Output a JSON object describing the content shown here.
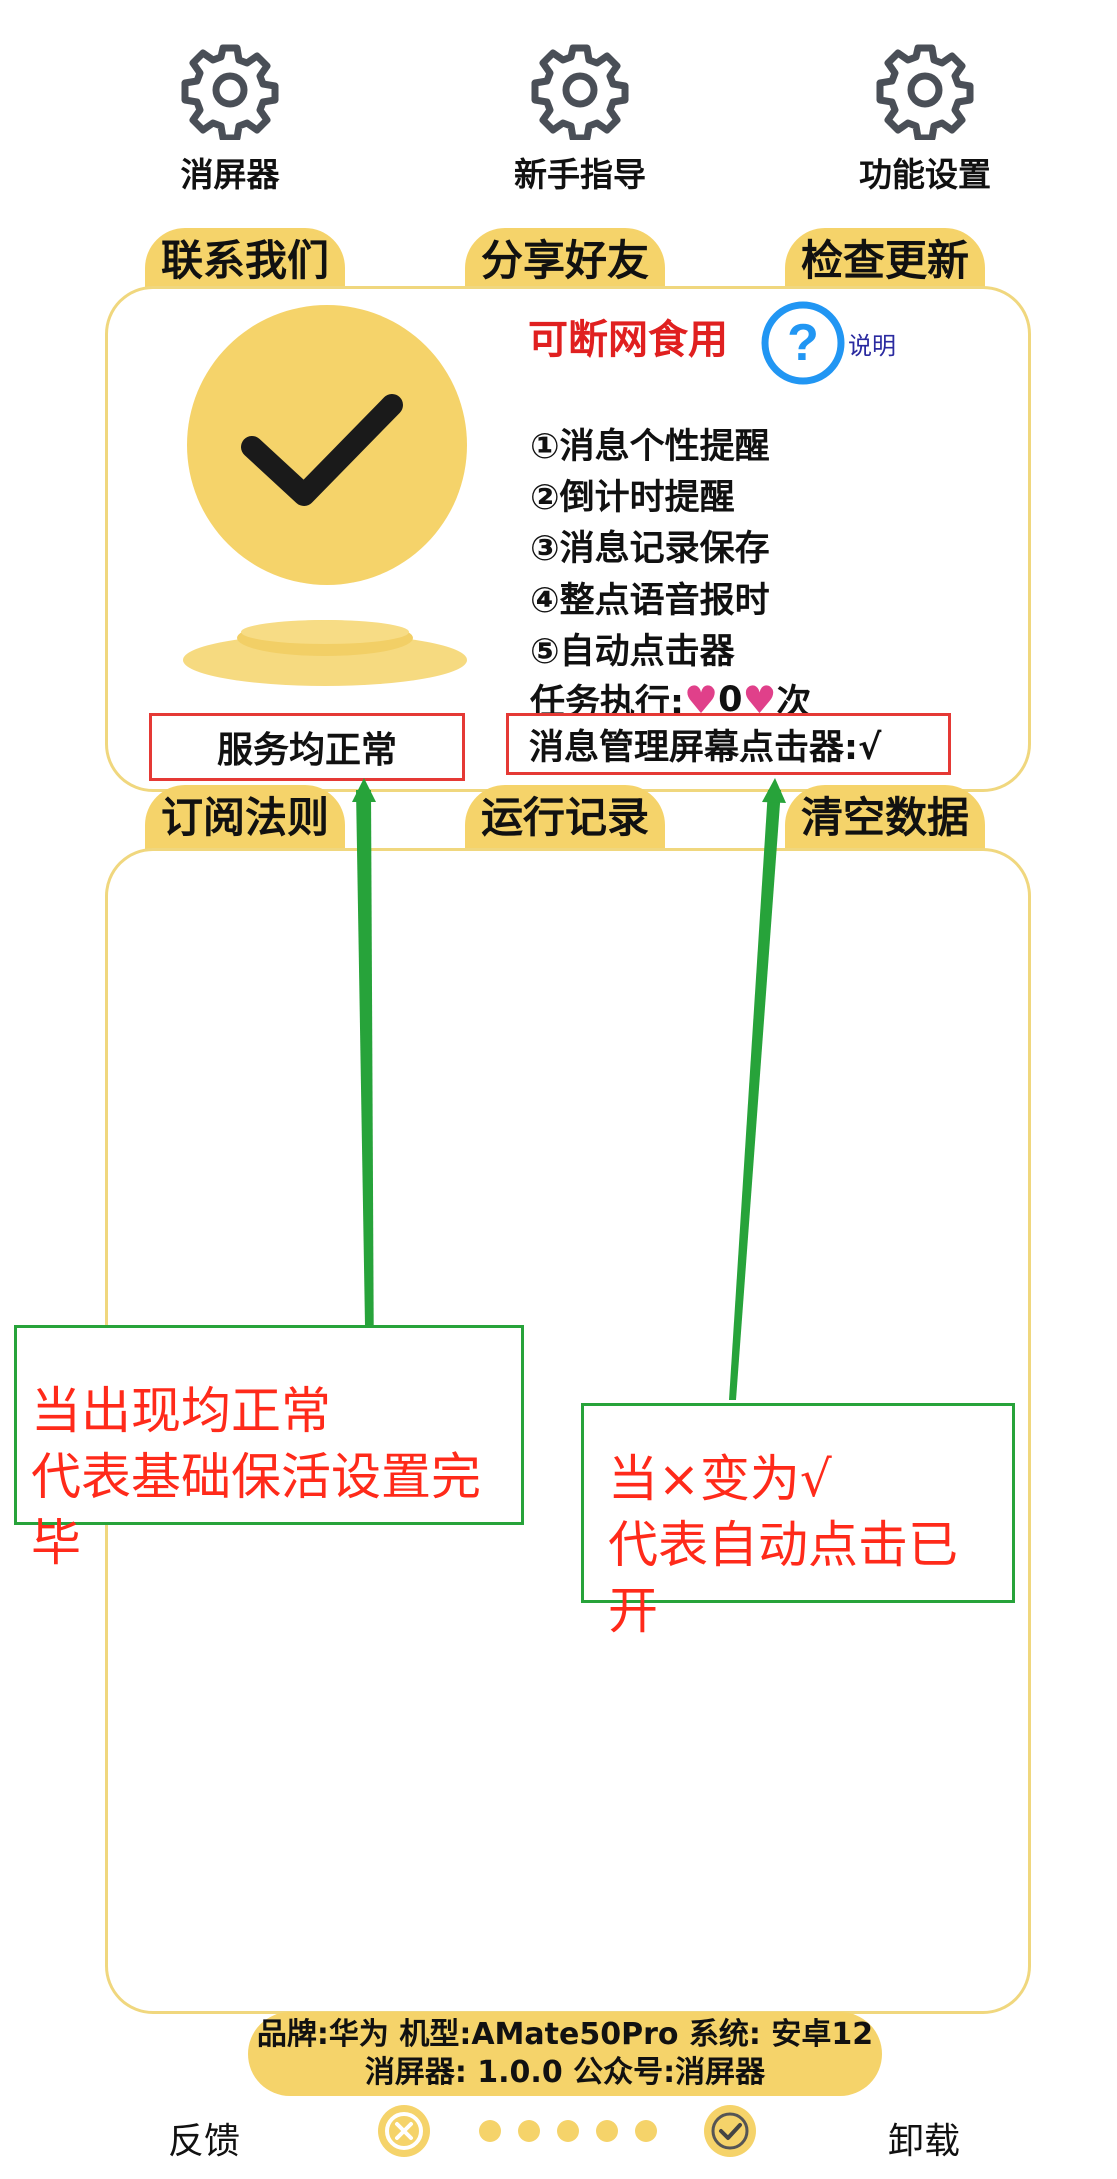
{
  "top_buttons": [
    {
      "label": "消屏器",
      "icon": "gear-icon"
    },
    {
      "label": "新手指导",
      "icon": "gear-icon"
    },
    {
      "label": "功能设置",
      "icon": "gear-icon"
    }
  ],
  "tabs_row1": [
    "联系我们",
    "分享好友",
    "检查更新"
  ],
  "status_panel": {
    "offline_title": "可断网食用",
    "explain_label": "说明",
    "features": [
      "①消息个性提醒",
      "②倒计时提醒",
      "③消息记录保存",
      "④整点语音报时",
      "⑤自动点击器"
    ],
    "task_prefix": "任务执行:",
    "task_count": "0",
    "task_suffix": "次",
    "service_status": "服务均正常",
    "clicker_status": "消息管理屏幕点击器:√"
  },
  "tabs_row2": [
    "订阅法则",
    "运行记录",
    "清空数据"
  ],
  "annotations": {
    "left_line1": "当出现均正常",
    "left_line2": "代表基础保活设置完毕",
    "right_line1": "当×变为√",
    "right_line2": "代表自动点击已开"
  },
  "device_info": {
    "line1": "品牌:华为 机型:AMate50Pro 系统: 安卓12",
    "line2": "消屏器: 1.0.0 公众号:消屏器"
  },
  "bottom_bar": {
    "feedback": "反馈",
    "uninstall": "卸载",
    "page_count": 5
  },
  "colors": {
    "accent": "#f5d36a",
    "annotation_red": "#ff2a1a",
    "annotation_green": "#27a33a",
    "title_red": "#e02020",
    "help_blue": "#2196f3"
  }
}
